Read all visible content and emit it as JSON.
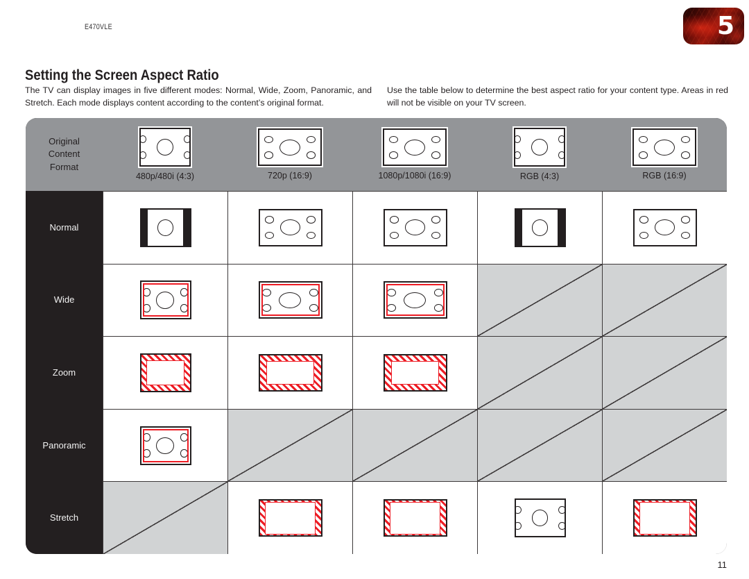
{
  "header": {
    "model": "E470VLE",
    "chapter_badge": "5"
  },
  "section": {
    "title": "Setting the Screen Aspect Ratio",
    "intro_left": "The TV can display images in five different modes: Normal, Wide, Zoom, Panoramic, and Stretch. Each mode displays content according to the content’s original format.",
    "intro_right": "Use the table below to determine the best aspect ratio for your content type. Areas in red will not be visible on your TV screen."
  },
  "table": {
    "corner_label_lines": [
      "Original",
      "Content",
      "Format"
    ],
    "columns": [
      {
        "caption": "480p/480i (4:3)",
        "source": "4:3"
      },
      {
        "caption": "720p (16:9)",
        "source": "16:9"
      },
      {
        "caption": "1080p/1080i (16:9)",
        "source": "16:9"
      },
      {
        "caption": "RGB (4:3)",
        "source": "4:3"
      },
      {
        "caption": "RGB (16:9)",
        "source": "16:9"
      }
    ],
    "rows": [
      {
        "label": "Normal",
        "cells": [
          "pillarbox",
          "plain",
          "plain",
          "pillarbox",
          "plain"
        ]
      },
      {
        "label": "Wide",
        "cells": [
          "crop-thin",
          "crop-thin",
          "crop-thin",
          "disabled",
          "disabled"
        ]
      },
      {
        "label": "Zoom",
        "cells": [
          "crop-hatch-all",
          "crop-hatch-all",
          "crop-hatch-all",
          "disabled",
          "disabled"
        ]
      },
      {
        "label": "Panoramic",
        "cells": [
          "crop-thin",
          "disabled",
          "disabled",
          "disabled",
          "disabled"
        ]
      },
      {
        "label": "Stretch",
        "cells": [
          "disabled",
          "crop-hatch-sides",
          "crop-hatch-sides",
          "plain",
          "crop-hatch-sides"
        ]
      }
    ]
  },
  "footer": {
    "page_number": "11"
  },
  "colors": {
    "header_band": "#939598",
    "row_label_bg": "#231f20",
    "disabled_cell": "#d1d3d4",
    "crop_red": "#ed1c24",
    "ink": "#231f20"
  }
}
